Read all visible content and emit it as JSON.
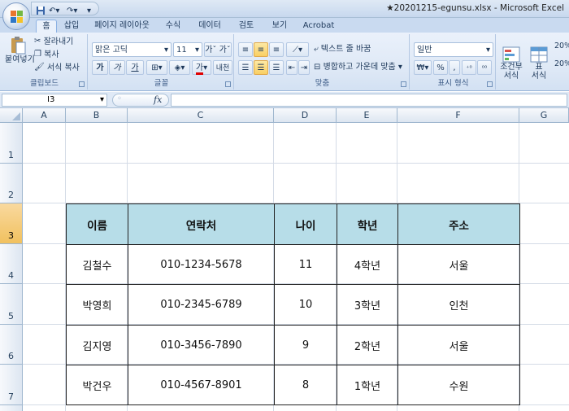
{
  "titlebar": {
    "title": "★20201215-egunsu.xlsx - Microsoft Excel"
  },
  "tabs": [
    "홈",
    "삽입",
    "페이지 레이아웃",
    "수식",
    "데이터",
    "검토",
    "보기",
    "Acrobat"
  ],
  "ribbon": {
    "clipboard": {
      "paste": "붙여넣기",
      "cut": "잘라내기",
      "copy": "복사",
      "format_painter": "서식 복사",
      "label": "클립보드"
    },
    "font": {
      "name": "맑은 고딕",
      "size": "11",
      "bold": "가",
      "italic": "가",
      "underline": "가",
      "color_a": "가",
      "phonetic": "내천",
      "label": "글꼴"
    },
    "alignment": {
      "wrap": "텍스트 줄 바꿈",
      "merge": "병합하고 가운데 맞춤",
      "label": "맞춤"
    },
    "number": {
      "format": "일반",
      "currency": "₩",
      "percent": "%",
      "comma": ",",
      "label": "표시 형식"
    },
    "styles": {
      "conditional": "조건부\n서식",
      "table": "표\n서식",
      "cell_style_1": "20%",
      "cell_style_2": "20%"
    }
  },
  "formula_bar": {
    "name_box": "I3",
    "fx": "fx",
    "content": ""
  },
  "columns": [
    "A",
    "B",
    "C",
    "D",
    "E",
    "F",
    "G"
  ],
  "rows": [
    "1",
    "2",
    "3",
    "4",
    "5",
    "6",
    "7"
  ],
  "selected": {
    "column": "I",
    "row": "3"
  },
  "table": {
    "headers": [
      "이름",
      "연락처",
      "나이",
      "학년",
      "주소"
    ],
    "rows": [
      [
        "김철수",
        "010-1234-5678",
        "11",
        "4학년",
        "서울"
      ],
      [
        "박영희",
        "010-2345-6789",
        "10",
        "3학년",
        "인천"
      ],
      [
        "김지영",
        "010-3456-7890",
        "9",
        "2학년",
        "서울"
      ],
      [
        "박건우",
        "010-4567-8901",
        "8",
        "1학년",
        "수원"
      ]
    ]
  },
  "colors": {
    "header_fill": "#b7dde8",
    "ribbon": "#dfe9f6",
    "selection": "#f1c15f"
  }
}
